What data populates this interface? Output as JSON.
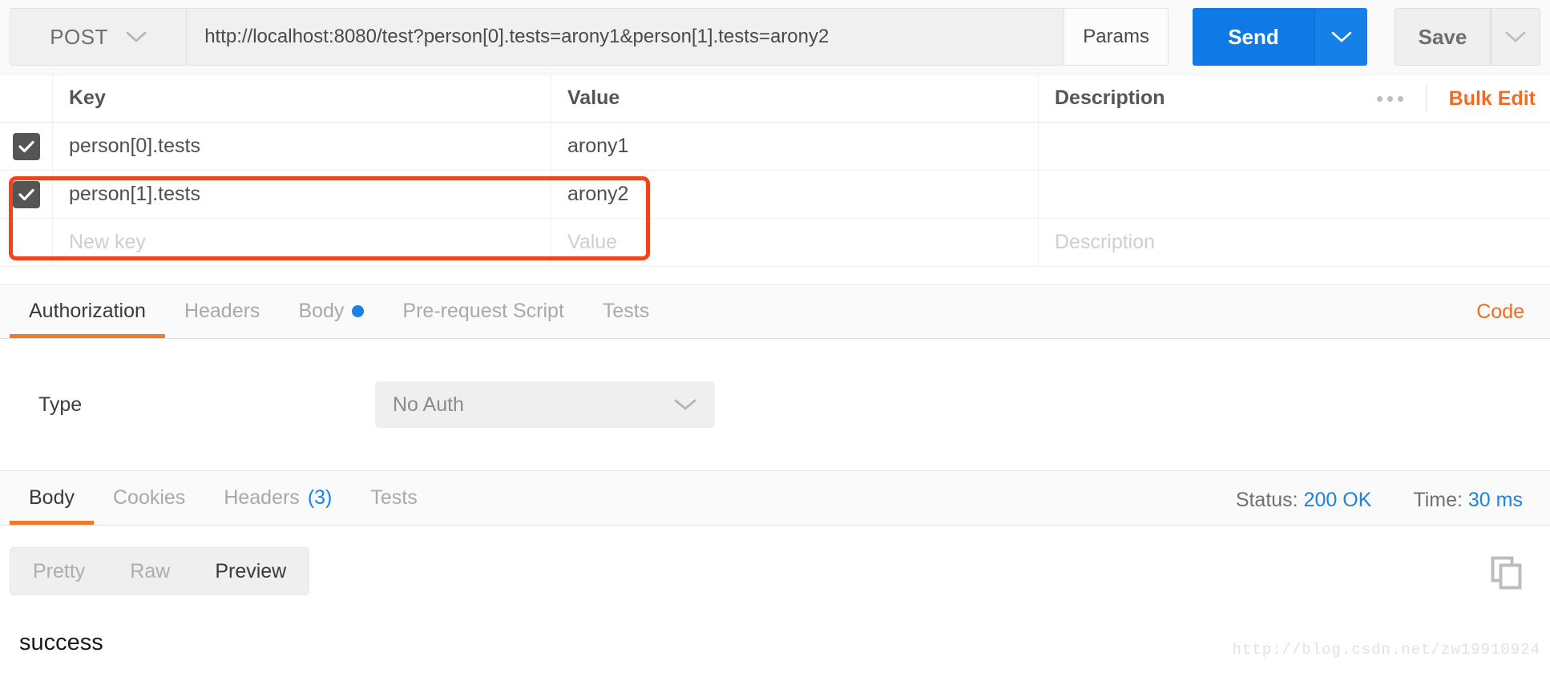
{
  "request_bar": {
    "method": "POST",
    "method_caret_icon": "chevron-down-icon",
    "url": "http://localhost:8080/test?person[0].tests=arony1&person[1].tests=arony2",
    "params_label": "Params",
    "send_label": "Send",
    "send_caret_icon": "chevron-down-icon",
    "save_label": "Save",
    "save_caret_icon": "chevron-down-icon"
  },
  "params_table": {
    "columns": {
      "key": "Key",
      "value": "Value",
      "description": "Description"
    },
    "more_icon": "ellipsis-icon",
    "bulk_edit_label": "Bulk Edit",
    "rows": [
      {
        "checked": true,
        "key": "person[0].tests",
        "value": "arony1",
        "description": ""
      },
      {
        "checked": true,
        "key": "person[1].tests",
        "value": "arony2",
        "description": ""
      }
    ],
    "new_row": {
      "key_placeholder": "New key",
      "value_placeholder": "Value",
      "description_placeholder": "Description"
    },
    "annotation": {
      "color": "#f4431c",
      "shape": "rounded-rectangle"
    }
  },
  "request_tabs": {
    "items": [
      {
        "label": "Authorization",
        "active": true,
        "dot": false
      },
      {
        "label": "Headers",
        "active": false,
        "dot": false
      },
      {
        "label": "Body",
        "active": false,
        "dot": true
      },
      {
        "label": "Pre-request Script",
        "active": false,
        "dot": false
      },
      {
        "label": "Tests",
        "active": false,
        "dot": false
      }
    ],
    "code_link": "Code",
    "active_underline_color": "#f3792a",
    "dot_color": "#1b7fe8"
  },
  "auth_panel": {
    "type_label": "Type",
    "selected_type": "No Auth",
    "caret_icon": "chevron-down-icon"
  },
  "response_tabs": {
    "items": [
      {
        "label": "Body",
        "count": "",
        "active": true
      },
      {
        "label": "Cookies",
        "count": "",
        "active": false
      },
      {
        "label": "Headers",
        "count": "(3)",
        "active": false
      },
      {
        "label": "Tests",
        "count": "",
        "active": false
      }
    ],
    "status_label": "Status:",
    "status_value": "200 OK",
    "time_label": "Time:",
    "time_value": "30 ms",
    "value_color": "#1a82e8"
  },
  "response_body": {
    "view_modes": [
      {
        "label": "Pretty",
        "active": false
      },
      {
        "label": "Raw",
        "active": false
      },
      {
        "label": "Preview",
        "active": true
      }
    ],
    "copy_icon": "copy-icon",
    "content": "success"
  },
  "watermark": "http://blog.csdn.net/zw19910924"
}
